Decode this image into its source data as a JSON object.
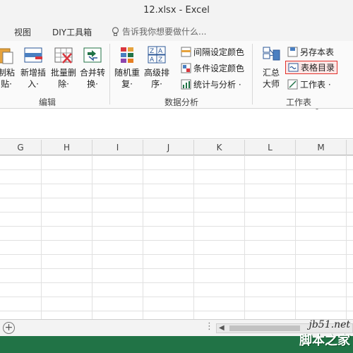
{
  "window": {
    "title": "12.xlsx - Excel"
  },
  "menu": {
    "items": [
      "视图",
      "DIY工具箱"
    ],
    "tell_me": "告诉我你想要做什么..."
  },
  "ribbon": {
    "groups": [
      {
        "label": "编辑",
        "buttons": [
          "制粘\n贴·",
          "新增插\n入·",
          "批量删\n除·",
          "合并转\n换·"
        ]
      },
      {
        "label": "数据分析",
        "buttons": [
          "随机重\n复·",
          "高级排\n序·"
        ],
        "small": [
          "间隔设定颜色",
          "条件设定颜色",
          "统计与分析 ·"
        ]
      },
      {
        "label": "工作表",
        "buttons": [
          "汇总\n大师"
        ],
        "small": [
          "另存本表",
          "表格目录",
          "工作表 ·"
        ]
      }
    ]
  },
  "grid": {
    "columns": [
      "G",
      "H",
      "I",
      "J",
      "K",
      "L",
      "M"
    ]
  },
  "sheetbar": {
    "add_label": "+",
    "dots": "⋮"
  },
  "watermark": {
    "line1": "jb51.net",
    "line2": "脚本之家"
  },
  "colors": {
    "accent": "#217346",
    "highlight_border": "#e0302a"
  }
}
